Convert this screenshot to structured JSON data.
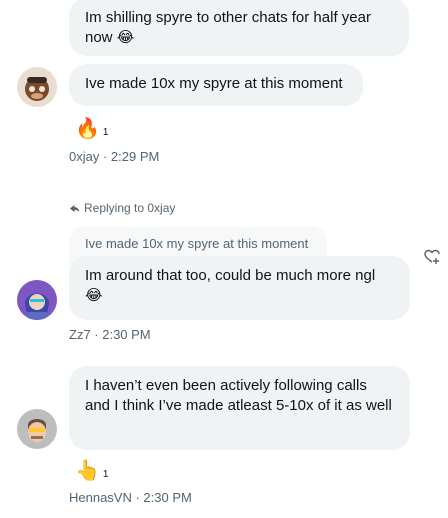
{
  "messages": [
    {
      "text": "Im shilling spyre to other chats for half year now",
      "emoji": "😂"
    },
    {
      "text": "Ive made 10x my spyre at this moment",
      "reaction": {
        "emoji": "🔥",
        "count": "1"
      },
      "meta": "0xjay · 2:29 PM"
    },
    {
      "reply_label": "Replying to 0xjay",
      "quoted": "Ive made 10x my spyre at this moment",
      "text": "Im around that too, could be much more ngl",
      "emoji": "😂",
      "meta": "Zz7 · 2:30 PM"
    },
    {
      "text": "I haven’t even been actively following calls and I think I’ve made atleast 5-10x of it as well",
      "reaction": {
        "emoji": "👆",
        "count": "1"
      },
      "meta": "HennasVN · 2:30 PM"
    }
  ],
  "icons": [
    "reply-arrow-icon",
    "add-reaction-icon"
  ]
}
